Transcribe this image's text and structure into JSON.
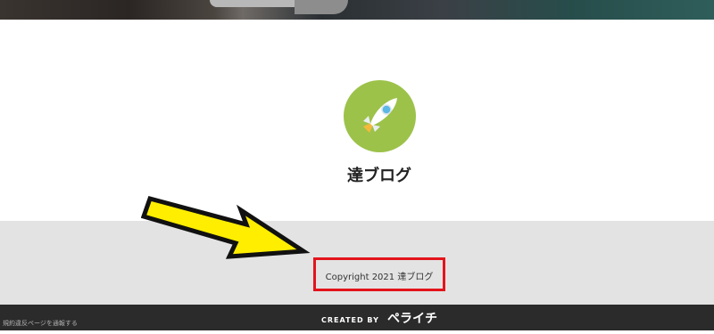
{
  "site": {
    "title": "達ブログ",
    "logo_icon": "rocket-icon",
    "logo_bg_color": "#9cc24a"
  },
  "footer": {
    "copyright": "Copyright 2021 達ブログ",
    "highlight_color": "#e3141b"
  },
  "bottom_bar": {
    "report_link": "規約違反ページを通報する",
    "created_by": "CREATED BY",
    "brand": "ペライチ"
  },
  "annotation": {
    "arrow_icon": "yellow-arrow-icon",
    "arrow_color": "#ffee00"
  }
}
